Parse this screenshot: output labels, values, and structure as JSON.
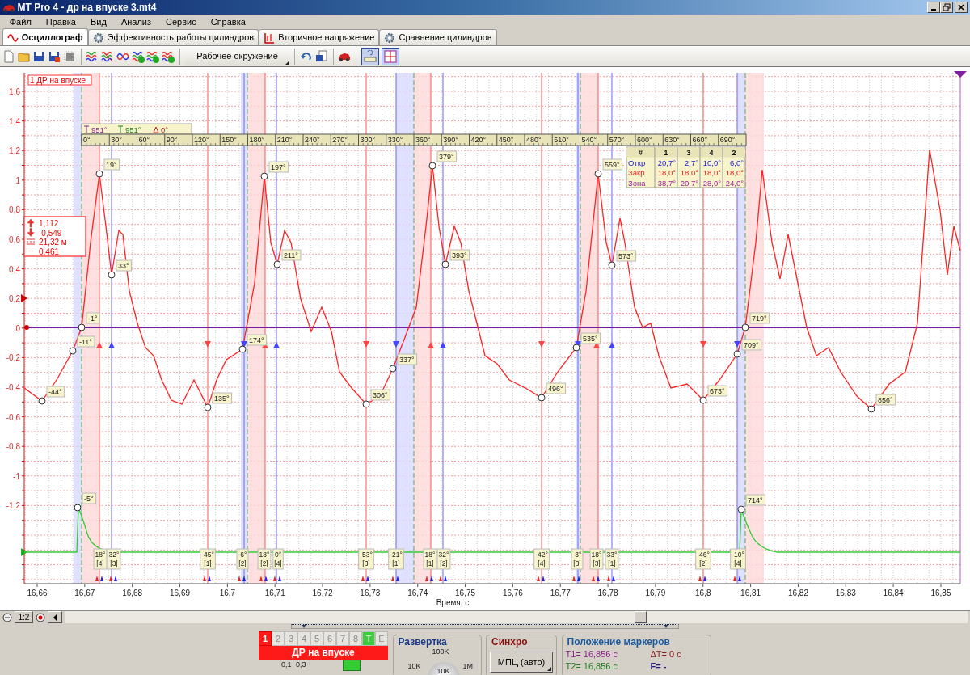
{
  "window": {
    "title": "MT Pro 4 - др на впуске  3.mt4"
  },
  "menu": [
    "Файл",
    "Правка",
    "Вид",
    "Анализ",
    "Сервис",
    "Справка"
  ],
  "tabs": [
    {
      "label": "Осциллограф",
      "selected": true,
      "kind": "scope"
    },
    {
      "label": "Эффективность работы цилиндров",
      "selected": false,
      "kind": "gear"
    },
    {
      "label": "Вторичное напряжение",
      "selected": false,
      "kind": "spark"
    },
    {
      "label": "Сравнение цилиндров",
      "selected": false,
      "kind": "gear"
    }
  ],
  "toolbar": {
    "environment_button": "Рабочее окружение"
  },
  "plot": {
    "channel_label": {
      "number": "1",
      "name": "ДР на впуске"
    },
    "y_ticks": [
      "1,6",
      "1,4",
      "1,2",
      "1",
      "0,8",
      "0,6",
      "0,4",
      "0,2",
      "0",
      "-0,2",
      "-0,4",
      "-0,6",
      "-0,8",
      "-1",
      "-1,2"
    ],
    "x_ticks": [
      "16,66",
      "16,67",
      "16,68",
      "16,69",
      "16,7",
      "16,71",
      "16,72",
      "16,73",
      "16,74",
      "16,75",
      "16,76",
      "16,77",
      "16,78",
      "16,79",
      "16,8",
      "16,81",
      "16,82",
      "16,83",
      "16,84",
      "16,85"
    ],
    "x_label": "Время, с",
    "stats": [
      {
        "kind": "max",
        "value": "1,112"
      },
      {
        "kind": "min",
        "value": "-0,549"
      },
      {
        "kind": "period",
        "value": "21,32 м"
      },
      {
        "kind": "mean",
        "value": "0,461"
      }
    ],
    "ruler": {
      "marker_1": "951°",
      "marker_2": "951°",
      "delta": "0°",
      "ticks": [
        "0°",
        "30°",
        "60°",
        "90°",
        "120°",
        "150°",
        "180°",
        "210°",
        "240°",
        "270°",
        "300°",
        "330°",
        "360°",
        "390°",
        "420°",
        "450°",
        "480°",
        "510°",
        "540°",
        "570°",
        "600°",
        "630°",
        "660°",
        "690°"
      ]
    },
    "valve_table": {
      "columns": [
        "#",
        "1",
        "3",
        "4",
        "2"
      ],
      "rows": [
        {
          "label": "Откр",
          "kind": "open",
          "values": [
            "20,7°",
            "2,7°",
            "10,0°",
            "6,0°"
          ]
        },
        {
          "label": "Закр",
          "kind": "close",
          "values": [
            "18,0°",
            "18,0°",
            "18,0°",
            "18,0°"
          ]
        },
        {
          "label": "Зона",
          "kind": "zone",
          "values": [
            "38,7°",
            "20,7°",
            "28,0°",
            "24,0°"
          ]
        }
      ]
    },
    "point_labels": [
      "-44°",
      "-11°",
      "-1°",
      "19°",
      "33°",
      "135°",
      "174°",
      "197°",
      "211°",
      "306°",
      "337°",
      "379°",
      "393°",
      "496°",
      "535°",
      "559°",
      "573°",
      "673°",
      "709°",
      "719°",
      "856°",
      "-5°",
      "714°"
    ],
    "event_labels": [
      {
        "angle": "18°",
        "cylinder": "[4]"
      },
      {
        "angle": "32°",
        "cylinder": "[3]"
      },
      {
        "angle": "-45°",
        "cylinder": "[1]"
      },
      {
        "angle": "-6°",
        "cylinder": "[2]"
      },
      {
        "angle": "18°",
        "cylinder": "[2]"
      },
      {
        "angle": "0°",
        "cylinder": "[4]"
      },
      {
        "angle": "-53°",
        "cylinder": "[3]"
      },
      {
        "angle": "-21°",
        "cylinder": "[1]"
      },
      {
        "angle": "18°",
        "cylinder": "[1]"
      },
      {
        "angle": "32°",
        "cylinder": "[2]"
      },
      {
        "angle": "-42°",
        "cylinder": "[4]"
      },
      {
        "angle": "-3°",
        "cylinder": "[3]"
      },
      {
        "angle": "18°",
        "cylinder": "[3]"
      },
      {
        "angle": "33°",
        "cylinder": "[1]"
      },
      {
        "angle": "-46°",
        "cylinder": "[2]"
      },
      {
        "angle": "-10°",
        "cylinder": "[4]"
      }
    ]
  },
  "scroll": {
    "zoom": "1:2"
  },
  "channel_panel": {
    "tabs": [
      {
        "label": "1",
        "selected": true,
        "disabled": false,
        "kind": "channel"
      },
      {
        "label": "2",
        "selected": false,
        "disabled": true,
        "kind": "channel"
      },
      {
        "label": "3",
        "selected": false,
        "disabled": true,
        "kind": "channel"
      },
      {
        "label": "4",
        "selected": false,
        "disabled": true,
        "kind": "channel"
      },
      {
        "label": "5",
        "selected": false,
        "disabled": true,
        "kind": "channel"
      },
      {
        "label": "6",
        "selected": false,
        "disabled": true,
        "kind": "channel"
      },
      {
        "label": "7",
        "selected": false,
        "disabled": true,
        "kind": "channel"
      },
      {
        "label": "8",
        "selected": false,
        "disabled": true,
        "kind": "channel"
      },
      {
        "label": "T",
        "selected": false,
        "disabled": false,
        "kind": "trigger"
      },
      {
        "label": "E",
        "selected": false,
        "disabled": true,
        "kind": "channel"
      }
    ],
    "name": "ДР на впуске",
    "scale_labels": [
      "0,1",
      "0,3"
    ]
  },
  "sweep": {
    "title": "Развертка",
    "top": "100K",
    "left": "10K",
    "right": "1M",
    "value": "10K"
  },
  "sync": {
    "title": "Синхро",
    "mode": "МПЦ (авто)"
  },
  "markers": {
    "title": "Положение маркеров",
    "t1": "T1= 16,856 с",
    "delta": "ΔT= 0 с",
    "t2": "T2= 16,856 с",
    "f": "F= -"
  }
}
